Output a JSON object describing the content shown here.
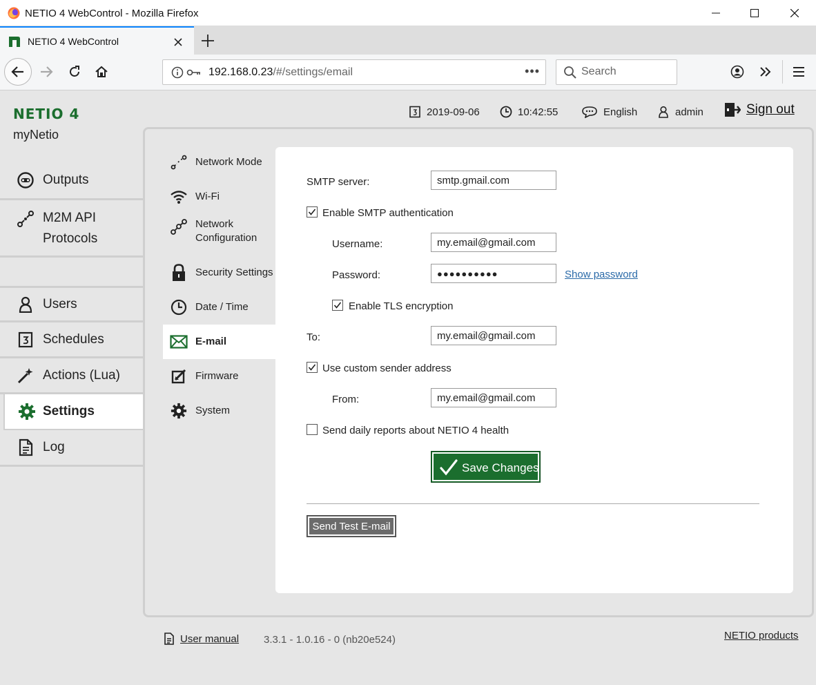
{
  "window": {
    "title": "NETIO 4 WebControl - Mozilla Firefox"
  },
  "tab": {
    "label": "NETIO 4 WebControl"
  },
  "urlbar": {
    "host": "192.168.0.23",
    "path": "/#/settings/email",
    "more": "•••"
  },
  "search": {
    "placeholder": "Search"
  },
  "brand": {
    "logo": "NETIO 4",
    "device": "myNetio",
    "color": "#1b6e2e"
  },
  "topbar": {
    "date": "2019-09-06",
    "time": "10:42:55",
    "language": "English",
    "user": "admin",
    "signout": "Sign out"
  },
  "sidebar": {
    "items": [
      {
        "label": "Outputs",
        "icon": "socket-icon"
      },
      {
        "label": "M2M API",
        "label2": "Protocols",
        "icon": "api-icon"
      },
      {
        "label": "Users",
        "icon": "user-icon"
      },
      {
        "label": "Schedules",
        "icon": "calendar-icon"
      },
      {
        "label": "Actions (Lua)",
        "icon": "wand-icon"
      },
      {
        "label": "Settings",
        "icon": "gear-icon",
        "active": true
      },
      {
        "label": "Log",
        "icon": "document-icon"
      }
    ]
  },
  "subnav": {
    "items": [
      {
        "label": "Network Mode",
        "icon": "network-mode-icon"
      },
      {
        "label": "Wi-Fi",
        "icon": "wifi-icon"
      },
      {
        "label": "Network",
        "label2": "Configuration",
        "icon": "network-config-icon"
      },
      {
        "label": "Security Settings",
        "icon": "lock-icon"
      },
      {
        "label": "Date / Time",
        "icon": "clock-icon"
      },
      {
        "label": "E-mail",
        "icon": "envelope-icon",
        "active": true
      },
      {
        "label": "Firmware",
        "icon": "firmware-icon"
      },
      {
        "label": "System",
        "icon": "gear-icon"
      }
    ]
  },
  "email_form": {
    "smtp_server_label": "SMTP server:",
    "smtp_server_value": "smtp.gmail.com",
    "enable_auth_label": "Enable SMTP authentication",
    "enable_auth_checked": true,
    "username_label": "Username:",
    "username_value": "my.email@gmail.com",
    "password_label": "Password:",
    "password_value": "●●●●●●●●●●",
    "show_password": "Show password",
    "tls_label": "Enable TLS encryption",
    "tls_checked": true,
    "to_label": "To:",
    "to_value": "my.email@gmail.com",
    "custom_sender_label": "Use custom sender address",
    "custom_sender_checked": true,
    "from_label": "From:",
    "from_value": "my.email@gmail.com",
    "daily_reports_label": "Send daily reports about NETIO 4 health",
    "daily_reports_checked": false,
    "save_button": "Save Changes",
    "test_button": "Send Test E-mail"
  },
  "footer": {
    "manual": "User manual",
    "version": "3.3.1 - 1.0.16 - 0 (nb20e524)",
    "products": "NETIO products"
  }
}
